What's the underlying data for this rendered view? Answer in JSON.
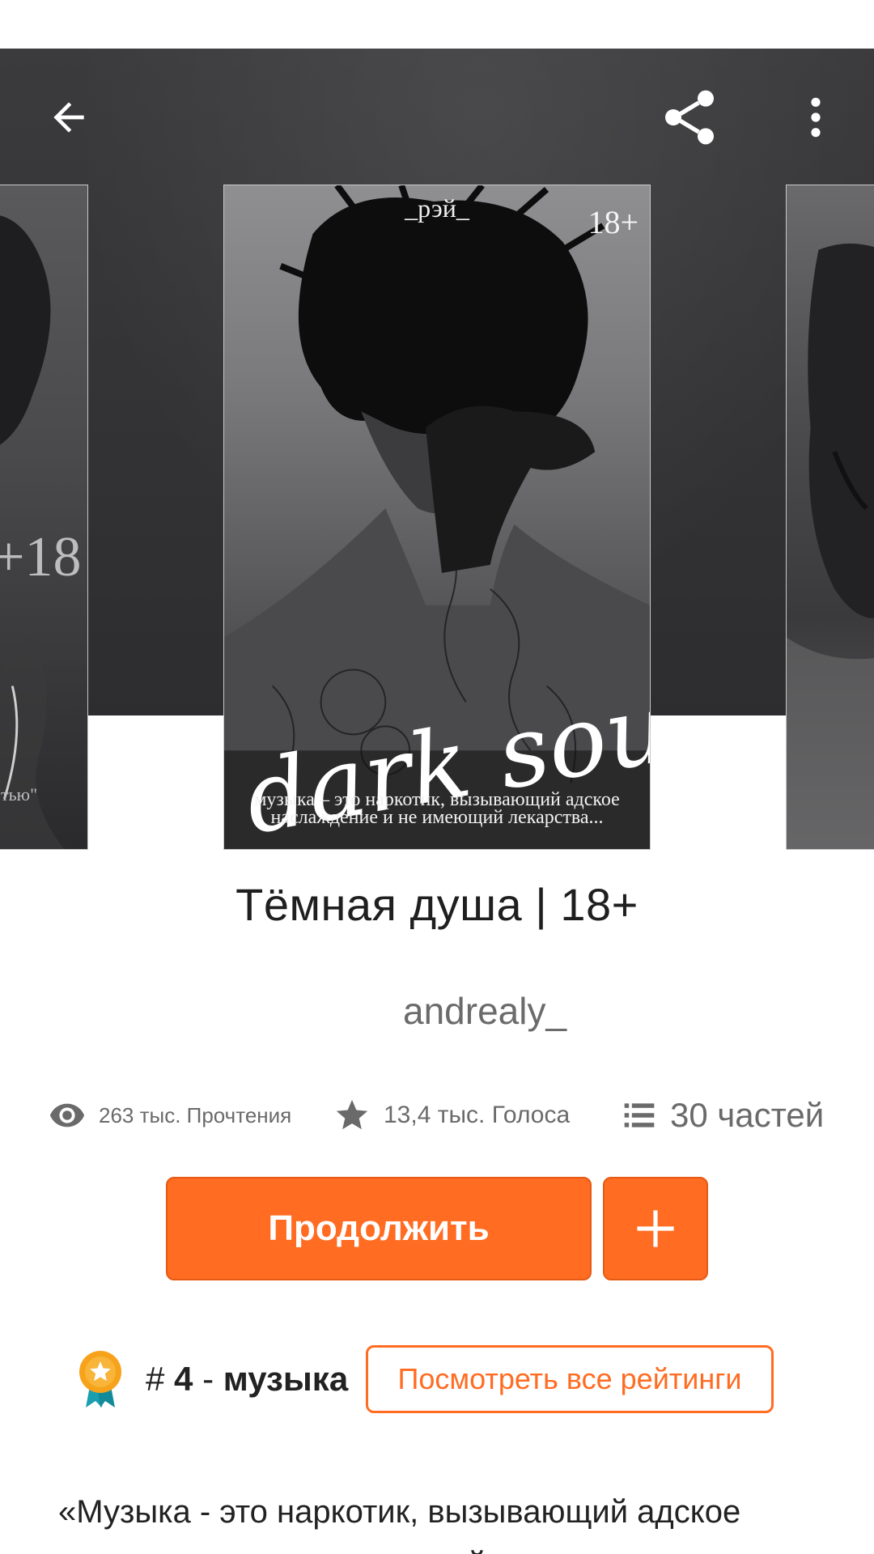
{
  "toolbar": {
    "back_icon": "arrow-left-icon",
    "share_icon": "share-icon",
    "more_icon": "more-vertical-icon"
  },
  "cover": {
    "author_tag": "_рэй_",
    "age_label": "18+",
    "script_title": "dark soul",
    "tagline": "музыка – это наркотик, вызывающий адское наслаждение и не имеющий лекарства..."
  },
  "prev_cover": {
    "age_label": "+18",
    "quote_fragment": "тью\""
  },
  "story": {
    "title": "Тёмная душа | 18+",
    "author": "andrealy_"
  },
  "stats": {
    "reads": "263 тыс. Прочтения",
    "votes": "13,4 тыс. Голоса",
    "parts": "30 частей"
  },
  "actions": {
    "continue_label": "Продолжить",
    "add_label": "+"
  },
  "ranking": {
    "hash": "#",
    "rank": "4",
    "separator": "-",
    "category": "музыка",
    "view_all_label": "Посмотреть все рейтинги"
  },
  "description": "«Музыка - это наркотик, вызывающий адское наслаждение и не имеющий лекарства",
  "colors": {
    "accent": "#ff6c22",
    "header_bg": "#333335",
    "text_primary": "#222222",
    "text_secondary": "#6a6a6a"
  }
}
